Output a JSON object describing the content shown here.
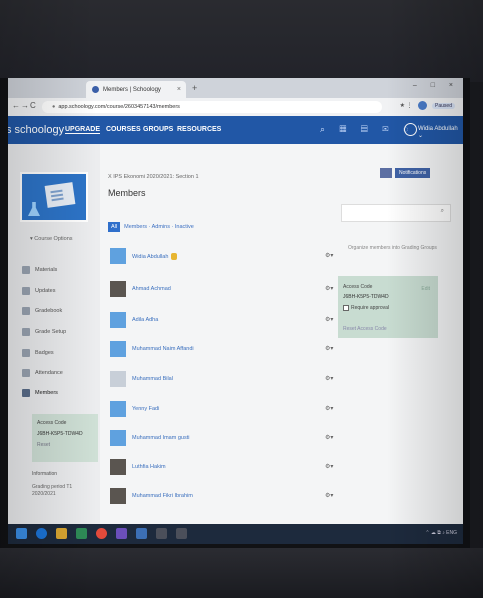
{
  "browser": {
    "tab_title": "Members | Schoology",
    "tab_close": "×",
    "new_tab": "+",
    "window_controls": "– □ ×",
    "url": "app.schoology.com/course/2603457143/members",
    "nav": {
      "back": "←",
      "forward": "→",
      "reload": "C"
    },
    "right_icons": "★ ⋮",
    "paused": "Paused"
  },
  "header": {
    "logo": "s schoology",
    "menu": [
      "UPGRADE",
      "COURSES",
      "GROUPS",
      "RESOURCES"
    ],
    "icons": "⌕ ▦ ▤ ✉ ◌",
    "user": "Widia Abdullah ⌄",
    "accent": "#2157a6"
  },
  "sidebar": {
    "course_options": "▾ Course Options",
    "items": [
      {
        "label": "Materials",
        "icon": "materials-icon"
      },
      {
        "label": "Updates",
        "icon": "updates-icon"
      },
      {
        "label": "Gradebook",
        "icon": "gradebook-icon"
      },
      {
        "label": "Grade Setup",
        "icon": "grade-setup-icon"
      },
      {
        "label": "Badges",
        "icon": "badges-icon"
      },
      {
        "label": "Attendance",
        "icon": "attendance-icon"
      },
      {
        "label": "Members",
        "icon": "members-icon"
      }
    ],
    "access_code": {
      "title": "Access Code",
      "code": "J6BH-K5P5-TDW4D",
      "reset": "Reset"
    },
    "information": "Information",
    "grading_period": "Grading period T1 2020/2021"
  },
  "main": {
    "breadcrumb": "X IPS Ekonomi 2020/2021: Section 1",
    "title": "Members",
    "filter": {
      "all": "All",
      "text": "Members · Admins · Inactive"
    },
    "members": [
      {
        "name": "Widia Abdullah",
        "avatar": "default",
        "badge": true
      },
      {
        "name": "Ahmad Achmad",
        "avatar": "photo",
        "badge": false
      },
      {
        "name": "Adila Adha",
        "avatar": "default",
        "badge": false
      },
      {
        "name": "Muhammad Naim Affandi",
        "avatar": "default",
        "badge": false
      },
      {
        "name": "Muhammad Bilal",
        "avatar": "cap",
        "badge": false
      },
      {
        "name": "Yenny Fadi",
        "avatar": "default",
        "badge": false
      },
      {
        "name": "Muhammad Imam gusti",
        "avatar": "default",
        "badge": false
      },
      {
        "name": "Luthfia Hakim",
        "avatar": "photo",
        "badge": false
      },
      {
        "name": "Muhammad Fikri Ibrahim",
        "avatar": "photo",
        "badge": false
      }
    ],
    "gear": "⚙▾"
  },
  "right": {
    "notifications": "Notifications",
    "search_icon": "⌕",
    "organization": "Organize members into Grading Groups",
    "access_code": {
      "title": "Access Code",
      "code": "J6BH-K5P5-TDW4D",
      "require": "Require approval",
      "reset": "Reset Access Code",
      "edit": "Edit"
    }
  },
  "taskbar": {
    "tray": "⌃ ☁ ⧉ ♪ ENG"
  }
}
